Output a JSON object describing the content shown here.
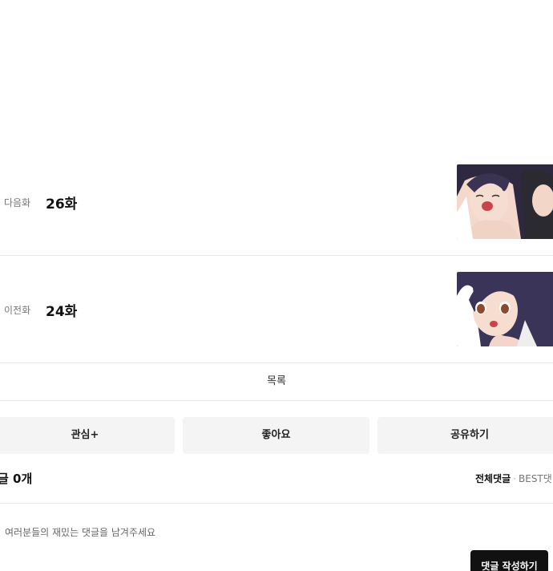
{
  "episodes": {
    "next": {
      "tag": "다음화",
      "title": "26화"
    },
    "prev": {
      "tag": "이전화",
      "title": "24화"
    }
  },
  "list_label": "목록",
  "actions": {
    "interest_label": "관심+",
    "like_label": "좋아요",
    "share_label": "공유하기"
  },
  "comments": {
    "count_label": "글 0개",
    "tab_all": "전체댓글",
    "tab_separator": "·",
    "tab_best": "BEST댓",
    "placeholder": "여러분들의 재밌는 댓글을 남겨주세요",
    "write_button": "댓글 작성하기"
  },
  "colors": {
    "button_bg": "#f4f4f4",
    "divider": "#e8e8e8",
    "write_button_bg": "#111111"
  }
}
